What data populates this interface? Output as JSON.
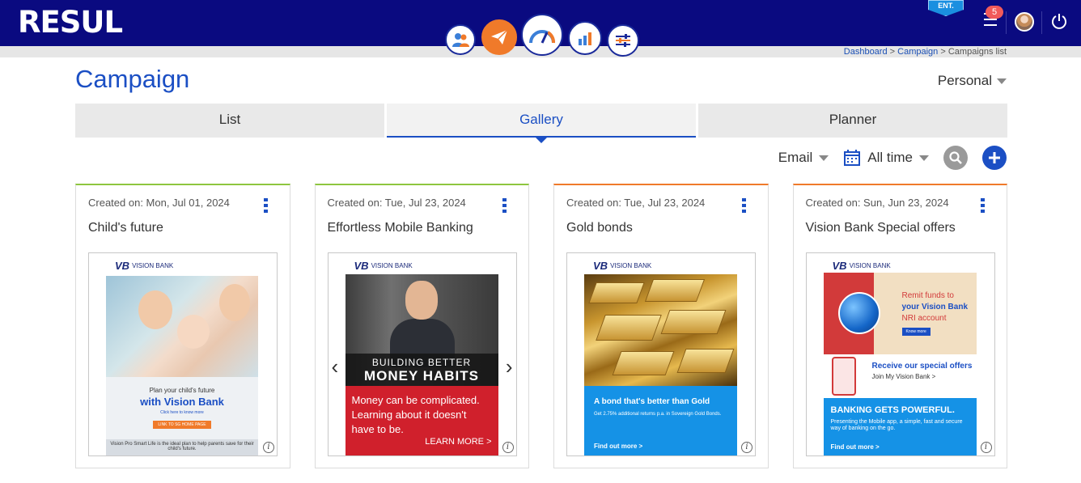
{
  "app": {
    "logo": "RESUL",
    "badge": "ENT.",
    "notifications": "5",
    "nav": [
      "audience-icon",
      "campaign-icon",
      "dashboard-icon",
      "analytics-icon",
      "settings-icon"
    ],
    "colors": {
      "header": "#0a0a80",
      "accent": "#1b4fc4",
      "active_nav": "#f07a2a"
    }
  },
  "breadcrumb": {
    "home": "Dashboard",
    "sep1": ">",
    "section": "Campaign",
    "sep2": ">",
    "current": "Campaigns list"
  },
  "page": {
    "title": "Campaign",
    "scope": "Personal"
  },
  "tabs": [
    {
      "label": "List"
    },
    {
      "label": "Gallery"
    },
    {
      "label": "Planner"
    }
  ],
  "filters": {
    "channel": "Email",
    "period": "All time"
  },
  "cards": [
    {
      "created": "Created on: Mon, Jul 01, 2024",
      "name": "Child's future",
      "brand": "VISION BANK",
      "l1": "Plan your child's future",
      "l2": "with Vision Bank",
      "l3": "Click here to know more",
      "btn": "LINK TO SG HOME PAGE",
      "foot": "Vision Pro Smart Life is the ideal plan to help parents save for their child's future."
    },
    {
      "created": "Created on: Tue, Jul 23, 2024",
      "name": "Effortless Mobile Banking",
      "brand": "VISION BANK",
      "s1": "BUILDING BETTER",
      "s2": "MONEY HABITS",
      "body": "Money can be complicated. Learning about it doesn't have to be.",
      "more": "LEARN MORE >"
    },
    {
      "created": "Created on: Tue, Jul 23, 2024",
      "name": "Gold bonds",
      "brand": "VISION BANK",
      "h": "A bond that's better than Gold",
      "t": "Get 2.75% additional returns p.a. in Sovereign Gold Bonds.",
      "m": "Find out more >"
    },
    {
      "created": "Created on: Sun, Jun 23, 2024",
      "name": "Vision Bank Special offers",
      "brand": "VISION BANK",
      "t1": "Remit funds to",
      "t2": "your Vision Bank",
      "t3": "NRI account",
      "km": "Know more",
      "mh": "Receive our special offers",
      "ms": "Join My Vision Bank >",
      "bh": "BANKING GETS POWERFUL.",
      "bt": "Presenting the Mobile app, a simple, fast and secure way of banking on the go.",
      "bm": "Find out more >"
    }
  ]
}
